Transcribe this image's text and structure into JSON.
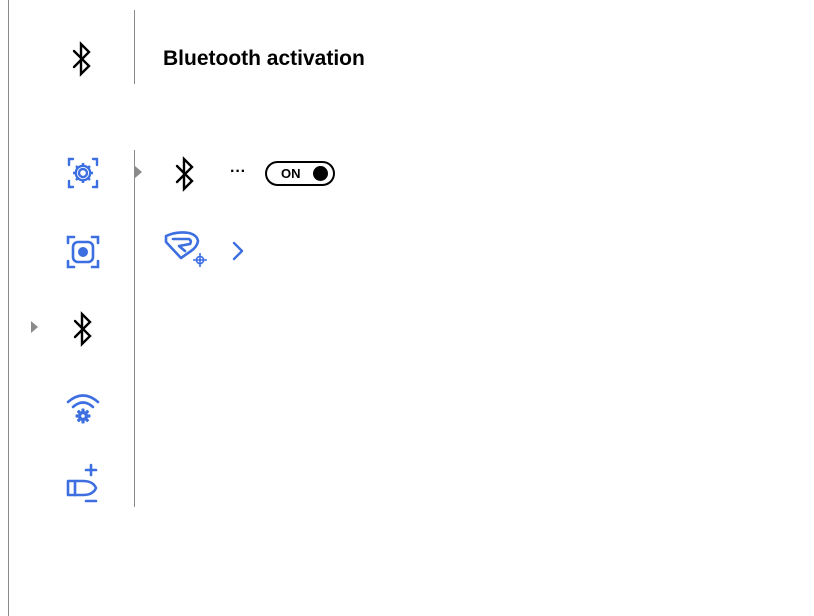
{
  "header": {
    "title": "Bluetooth activation",
    "icon": "bluetooth-icon"
  },
  "nav": {
    "items": [
      {
        "icon": "settings-gear-icon",
        "active": false
      },
      {
        "icon": "capture-mode-icon",
        "active": false
      },
      {
        "icon": "bluetooth-icon",
        "active": true
      },
      {
        "icon": "wifi-settings-icon",
        "active": false
      },
      {
        "icon": "ammo-profile-icon",
        "active": false
      }
    ]
  },
  "bluetooth_row": {
    "icon": "bluetooth-icon",
    "separator": "···",
    "toggle_label": "ON",
    "toggle_state": "on"
  },
  "app_row": {
    "icon": "app-logo-icon",
    "chevron": "chevron-right-icon"
  },
  "colors": {
    "accent": "#3d6fe0",
    "text": "#000000",
    "divider": "#8a8a8a"
  }
}
